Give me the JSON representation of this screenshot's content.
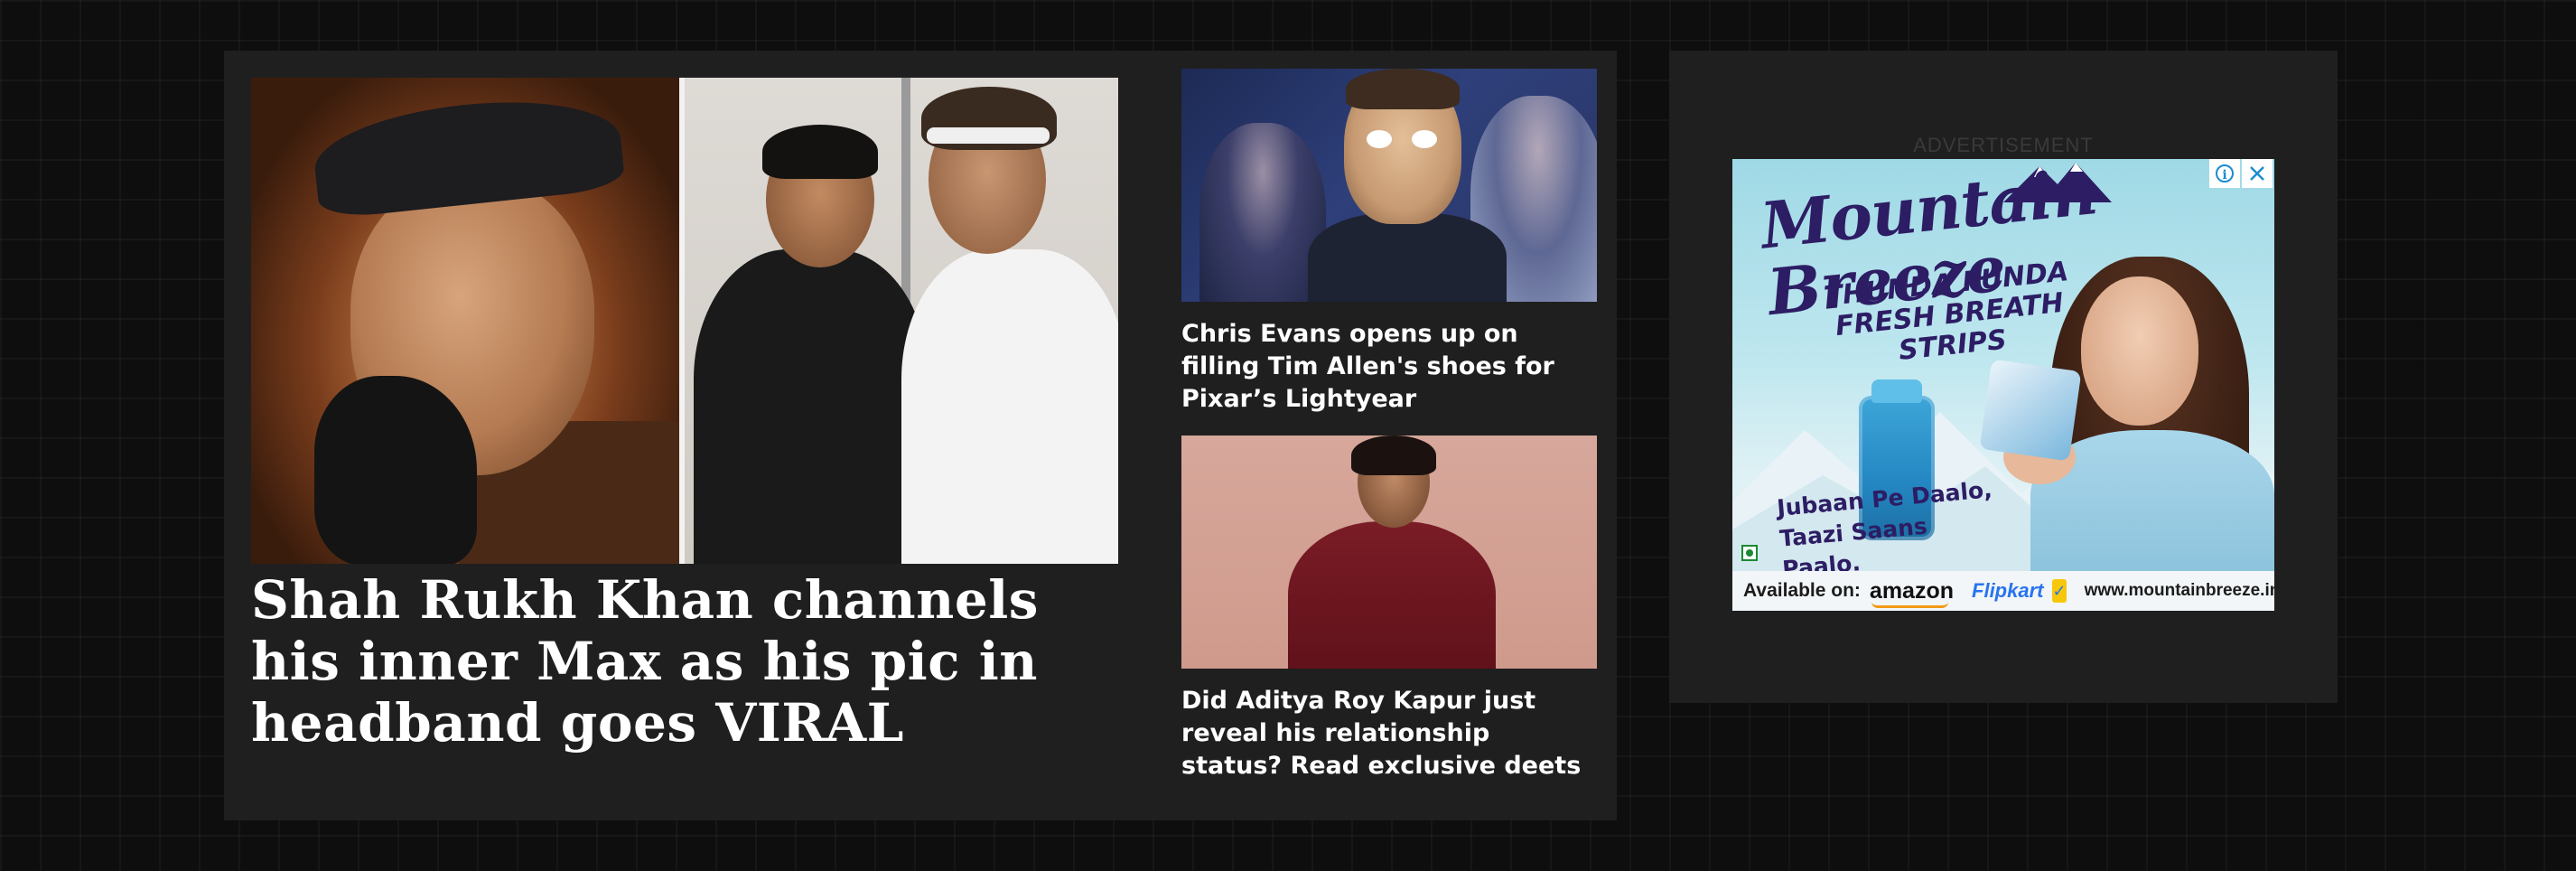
{
  "main_story": {
    "title": "Shah Rukh Khan channels his inner Max as his pic in headband goes VIRAL"
  },
  "side_stories": [
    {
      "title": "Chris Evans opens up on filling Tim Allen's shoes for Pixar’s Lightyear"
    },
    {
      "title": "Did Aditya Roy Kapur just reveal his relationship status? Read exclusive deets"
    }
  ],
  "advertisement": {
    "label": "ADVERTISEMENT",
    "brand": "Mountain Breeze",
    "tagline": "THUNDA FUNDA FRESH BREATH STRIPS",
    "slogan": "Jubaan Pe Daalo, Taazi Saans Paalo.",
    "available_on": "Available on:",
    "retailers": [
      "amazon",
      "Flipkart"
    ],
    "website": "www.mountainbreeze.in",
    "info_icon": "i",
    "colors": {
      "brand": "#2d1d64",
      "flipkart": "#2874f0",
      "amazon_smile": "#f39a16",
      "ad_choices": "#1b8ccf"
    }
  },
  "colors": {
    "page_background": "#0e0e0e",
    "panel": "#1f1f1f",
    "headline_text": "#ffffff"
  }
}
